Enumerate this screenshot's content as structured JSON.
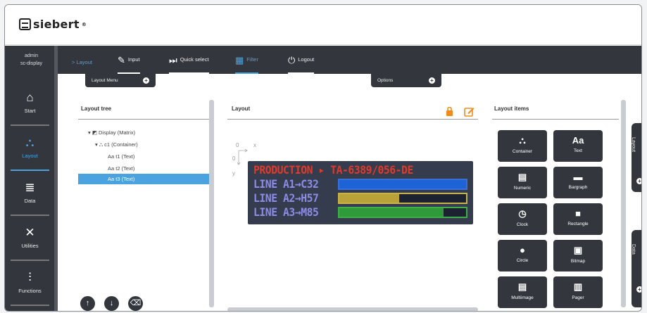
{
  "brand": {
    "name": "siebert",
    "reg": "®"
  },
  "sidebar": {
    "user_line1": "admin",
    "user_line2": "sc-display",
    "items": [
      {
        "label": "Start",
        "icon": "home-icon",
        "glyph": "⌂"
      },
      {
        "label": "Layout",
        "icon": "sitemap-icon",
        "glyph": "⛬"
      },
      {
        "label": "Data",
        "icon": "database-icon",
        "glyph": "≣"
      },
      {
        "label": "Utilities",
        "icon": "tools-icon",
        "glyph": "✕"
      },
      {
        "label": "Functions",
        "icon": "sliders-icon",
        "glyph": "⫶"
      }
    ]
  },
  "topbar": {
    "breadcrumb": "> Layout",
    "buttons": [
      {
        "label": "Input",
        "icon": "edit-icon",
        "glyph": "✎"
      },
      {
        "label": "Quick select",
        "icon": "fast-forward-icon",
        "glyph": "⏭"
      },
      {
        "label": "Filter",
        "icon": "grid-icon",
        "glyph": "▦"
      },
      {
        "label": "Logout",
        "icon": "power-icon",
        "glyph": "⏻"
      }
    ]
  },
  "menus": {
    "layout_menu": "Layout Menu",
    "options": "Options"
  },
  "tree_panel": {
    "title": "Layout tree",
    "rows": [
      {
        "text": "▾ ◩ Display (Matrix)"
      },
      {
        "text": "▾ ⛬ c1 (Container)"
      },
      {
        "text": "Aa t1 (Text)"
      },
      {
        "text": "Aa t2 (Text)"
      },
      {
        "text": "Aa t3 (Text)"
      }
    ]
  },
  "layout_panel": {
    "title": "Layout",
    "axis_x": "x",
    "axis_y": "y",
    "axis_origin": "0"
  },
  "display": {
    "line1": "PRODUCTION ▸ TA-6389/056-DE",
    "line2": "LINE A1→C32",
    "line3": "LINE A2→H57",
    "line4": "LINE A3→M85",
    "bars": [
      {
        "fill": 1.0,
        "color": "#1e63d6",
        "border": "#3a6fd8"
      },
      {
        "fill": 0.47,
        "color": "#b9a338",
        "border": "#c8b24a"
      },
      {
        "fill": 0.82,
        "color": "#2f9a3a",
        "border": "#3fae48"
      }
    ],
    "colors": {
      "title": "#e03a2a",
      "lines": "#8c8ce6"
    }
  },
  "items_panel": {
    "title": "Layout items",
    "items": [
      {
        "label": "Container",
        "icon": "sitemap-icon",
        "glyph": "⛬"
      },
      {
        "label": "Text",
        "icon": "text-icon",
        "glyph": "Aa"
      },
      {
        "label": "Numeric",
        "icon": "numeric-icon",
        "glyph": "▤"
      },
      {
        "label": "Bargraph",
        "icon": "bargraph-icon",
        "glyph": "▬"
      },
      {
        "label": "Clock",
        "icon": "clock-icon",
        "glyph": "◷"
      },
      {
        "label": "Rectangle",
        "icon": "rectangle-icon",
        "glyph": "■"
      },
      {
        "label": "Circle",
        "icon": "circle-icon",
        "glyph": "●"
      },
      {
        "label": "Bitmap",
        "icon": "image-icon",
        "glyph": "▣"
      },
      {
        "label": "Multiimage",
        "icon": "film-icon",
        "glyph": "▤"
      },
      {
        "label": "Pager",
        "icon": "pager-icon",
        "glyph": "▥"
      }
    ]
  },
  "right_tabs": {
    "layout": "Layout",
    "data": "Data"
  },
  "colors": {
    "accent": "#4aa3df",
    "dark": "#33373d",
    "warn": "#f08a1c"
  }
}
